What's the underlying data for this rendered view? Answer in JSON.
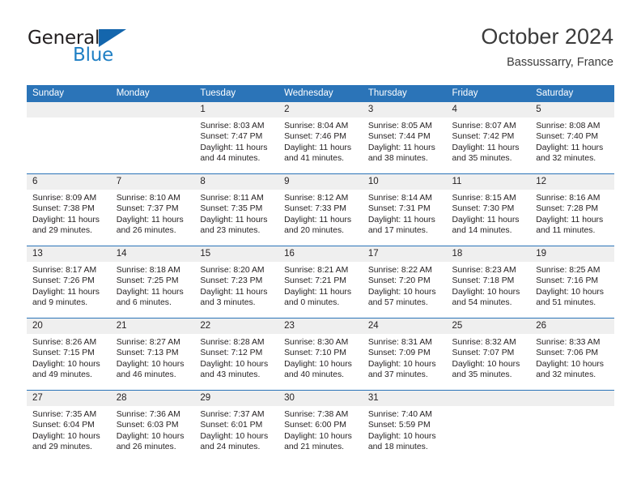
{
  "brand": {
    "line1": "General",
    "line2": "Blue",
    "flag_icon": "triangle-flag-icon",
    "colors": {
      "blue": "#1f7fc4",
      "flag": "#1466ad",
      "dark": "#231f20"
    }
  },
  "header": {
    "title": "October 2024",
    "subtitle": "Bassussarry, France"
  },
  "theme": {
    "header_blue": "#2b74b8",
    "daynum_gray": "#efefef",
    "text": "#231f20"
  },
  "calendar": {
    "weekday_headers": [
      "Sunday",
      "Monday",
      "Tuesday",
      "Wednesday",
      "Thursday",
      "Friday",
      "Saturday"
    ],
    "weeks": [
      [
        {
          "day": "",
          "lines": []
        },
        {
          "day": "",
          "lines": []
        },
        {
          "day": "1",
          "lines": [
            "Sunrise: 8:03 AM",
            "Sunset: 7:47 PM",
            "Daylight: 11 hours",
            "and 44 minutes."
          ]
        },
        {
          "day": "2",
          "lines": [
            "Sunrise: 8:04 AM",
            "Sunset: 7:46 PM",
            "Daylight: 11 hours",
            "and 41 minutes."
          ]
        },
        {
          "day": "3",
          "lines": [
            "Sunrise: 8:05 AM",
            "Sunset: 7:44 PM",
            "Daylight: 11 hours",
            "and 38 minutes."
          ]
        },
        {
          "day": "4",
          "lines": [
            "Sunrise: 8:07 AM",
            "Sunset: 7:42 PM",
            "Daylight: 11 hours",
            "and 35 minutes."
          ]
        },
        {
          "day": "5",
          "lines": [
            "Sunrise: 8:08 AM",
            "Sunset: 7:40 PM",
            "Daylight: 11 hours",
            "and 32 minutes."
          ]
        }
      ],
      [
        {
          "day": "6",
          "lines": [
            "Sunrise: 8:09 AM",
            "Sunset: 7:38 PM",
            "Daylight: 11 hours",
            "and 29 minutes."
          ]
        },
        {
          "day": "7",
          "lines": [
            "Sunrise: 8:10 AM",
            "Sunset: 7:37 PM",
            "Daylight: 11 hours",
            "and 26 minutes."
          ]
        },
        {
          "day": "8",
          "lines": [
            "Sunrise: 8:11 AM",
            "Sunset: 7:35 PM",
            "Daylight: 11 hours",
            "and 23 minutes."
          ]
        },
        {
          "day": "9",
          "lines": [
            "Sunrise: 8:12 AM",
            "Sunset: 7:33 PM",
            "Daylight: 11 hours",
            "and 20 minutes."
          ]
        },
        {
          "day": "10",
          "lines": [
            "Sunrise: 8:14 AM",
            "Sunset: 7:31 PM",
            "Daylight: 11 hours",
            "and 17 minutes."
          ]
        },
        {
          "day": "11",
          "lines": [
            "Sunrise: 8:15 AM",
            "Sunset: 7:30 PM",
            "Daylight: 11 hours",
            "and 14 minutes."
          ]
        },
        {
          "day": "12",
          "lines": [
            "Sunrise: 8:16 AM",
            "Sunset: 7:28 PM",
            "Daylight: 11 hours",
            "and 11 minutes."
          ]
        }
      ],
      [
        {
          "day": "13",
          "lines": [
            "Sunrise: 8:17 AM",
            "Sunset: 7:26 PM",
            "Daylight: 11 hours",
            "and 9 minutes."
          ]
        },
        {
          "day": "14",
          "lines": [
            "Sunrise: 8:18 AM",
            "Sunset: 7:25 PM",
            "Daylight: 11 hours",
            "and 6 minutes."
          ]
        },
        {
          "day": "15",
          "lines": [
            "Sunrise: 8:20 AM",
            "Sunset: 7:23 PM",
            "Daylight: 11 hours",
            "and 3 minutes."
          ]
        },
        {
          "day": "16",
          "lines": [
            "Sunrise: 8:21 AM",
            "Sunset: 7:21 PM",
            "Daylight: 11 hours",
            "and 0 minutes."
          ]
        },
        {
          "day": "17",
          "lines": [
            "Sunrise: 8:22 AM",
            "Sunset: 7:20 PM",
            "Daylight: 10 hours",
            "and 57 minutes."
          ]
        },
        {
          "day": "18",
          "lines": [
            "Sunrise: 8:23 AM",
            "Sunset: 7:18 PM",
            "Daylight: 10 hours",
            "and 54 minutes."
          ]
        },
        {
          "day": "19",
          "lines": [
            "Sunrise: 8:25 AM",
            "Sunset: 7:16 PM",
            "Daylight: 10 hours",
            "and 51 minutes."
          ]
        }
      ],
      [
        {
          "day": "20",
          "lines": [
            "Sunrise: 8:26 AM",
            "Sunset: 7:15 PM",
            "Daylight: 10 hours",
            "and 49 minutes."
          ]
        },
        {
          "day": "21",
          "lines": [
            "Sunrise: 8:27 AM",
            "Sunset: 7:13 PM",
            "Daylight: 10 hours",
            "and 46 minutes."
          ]
        },
        {
          "day": "22",
          "lines": [
            "Sunrise: 8:28 AM",
            "Sunset: 7:12 PM",
            "Daylight: 10 hours",
            "and 43 minutes."
          ]
        },
        {
          "day": "23",
          "lines": [
            "Sunrise: 8:30 AM",
            "Sunset: 7:10 PM",
            "Daylight: 10 hours",
            "and 40 minutes."
          ]
        },
        {
          "day": "24",
          "lines": [
            "Sunrise: 8:31 AM",
            "Sunset: 7:09 PM",
            "Daylight: 10 hours",
            "and 37 minutes."
          ]
        },
        {
          "day": "25",
          "lines": [
            "Sunrise: 8:32 AM",
            "Sunset: 7:07 PM",
            "Daylight: 10 hours",
            "and 35 minutes."
          ]
        },
        {
          "day": "26",
          "lines": [
            "Sunrise: 8:33 AM",
            "Sunset: 7:06 PM",
            "Daylight: 10 hours",
            "and 32 minutes."
          ]
        }
      ],
      [
        {
          "day": "27",
          "lines": [
            "Sunrise: 7:35 AM",
            "Sunset: 6:04 PM",
            "Daylight: 10 hours",
            "and 29 minutes."
          ]
        },
        {
          "day": "28",
          "lines": [
            "Sunrise: 7:36 AM",
            "Sunset: 6:03 PM",
            "Daylight: 10 hours",
            "and 26 minutes."
          ]
        },
        {
          "day": "29",
          "lines": [
            "Sunrise: 7:37 AM",
            "Sunset: 6:01 PM",
            "Daylight: 10 hours",
            "and 24 minutes."
          ]
        },
        {
          "day": "30",
          "lines": [
            "Sunrise: 7:38 AM",
            "Sunset: 6:00 PM",
            "Daylight: 10 hours",
            "and 21 minutes."
          ]
        },
        {
          "day": "31",
          "lines": [
            "Sunrise: 7:40 AM",
            "Sunset: 5:59 PM",
            "Daylight: 10 hours",
            "and 18 minutes."
          ]
        },
        {
          "day": "",
          "lines": []
        },
        {
          "day": "",
          "lines": []
        }
      ]
    ]
  }
}
